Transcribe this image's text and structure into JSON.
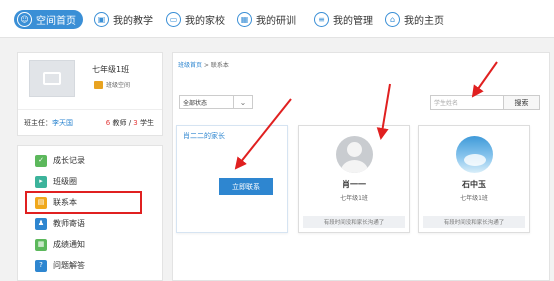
{
  "nav": {
    "items": [
      {
        "label": "空间首页",
        "icon": "person-icon",
        "active": true
      },
      {
        "label": "我的教学",
        "icon": "book-icon"
      },
      {
        "label": "我的家校",
        "icon": "monitor-icon"
      },
      {
        "label": "我的研训",
        "icon": "grid-icon"
      },
      {
        "label": "我的管理",
        "icon": "list-icon"
      },
      {
        "label": "我的主页",
        "icon": "home-icon"
      }
    ]
  },
  "class_card": {
    "name": "七年级1班",
    "space_label": "班级空间",
    "teacher_prefix": "班主任：",
    "teacher_name": "李天国",
    "teacher_count": "6",
    "teacher_unit": " 教师 / ",
    "student_count": "3",
    "student_unit": " 学生"
  },
  "menu": {
    "items": [
      {
        "label": "成长记录",
        "color": "#5cb85c",
        "glyph": "✓"
      },
      {
        "label": "班级圈",
        "color": "#3cb39b",
        "glyph": "▸"
      },
      {
        "label": "联系本",
        "color": "#f0a81c",
        "glyph": "▤",
        "selected": true
      },
      {
        "label": "教师寄语",
        "color": "#2e86d0",
        "glyph": "♟"
      },
      {
        "label": "成绩通知",
        "color": "#5cb85c",
        "glyph": "▦"
      },
      {
        "label": "问题解答",
        "color": "#2e86d0",
        "glyph": "?"
      }
    ]
  },
  "main": {
    "breadcrumb_home": "班级首页",
    "breadcrumb_sep": " > ",
    "breadcrumb_current": "联系本",
    "filter_value": "全部状态",
    "search_placeholder": "学生姓名",
    "search_button": "搜索",
    "cards": [
      {
        "label": "肖二二的家长",
        "button": "立即联系"
      },
      {
        "name": "肖一一",
        "class": "七年级1班",
        "footer": "有段时间没和家长沟通了"
      },
      {
        "name": "石中玉",
        "class": "七年级1班",
        "footer": "有段时间没和家长沟通了"
      }
    ]
  },
  "colors": {
    "accent": "#3a8fd6",
    "highlight": "#e02020"
  }
}
